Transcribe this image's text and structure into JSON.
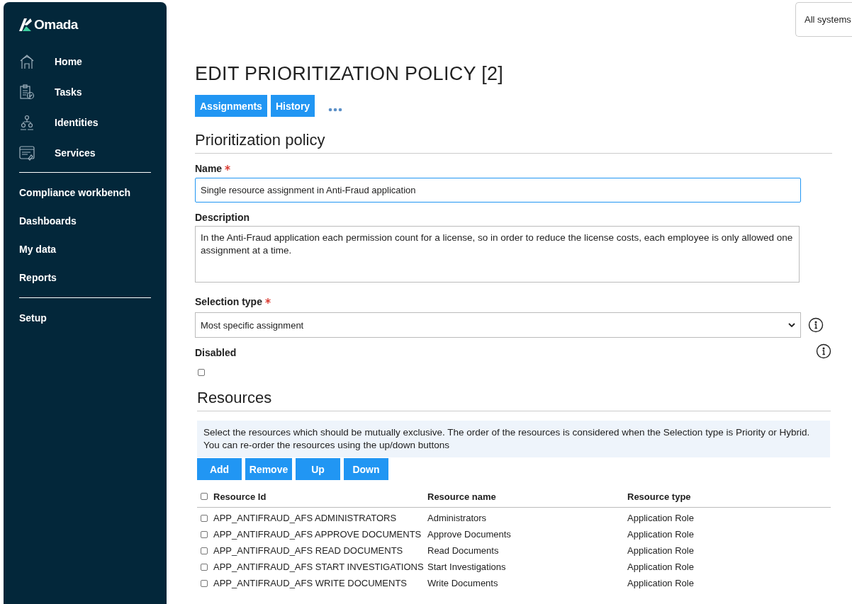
{
  "sidebar": {
    "logo": "Omada",
    "primary_items": [
      {
        "label": "Home"
      },
      {
        "label": "Tasks"
      },
      {
        "label": "Identities"
      },
      {
        "label": "Services"
      }
    ],
    "secondary_items": [
      {
        "label": "Compliance workbench"
      },
      {
        "label": "Dashboards"
      },
      {
        "label": "My data"
      },
      {
        "label": "Reports"
      }
    ],
    "tertiary_items": [
      {
        "label": "Setup"
      }
    ]
  },
  "system_filter": "All systems",
  "page_title": "EDIT PRIORITIZATION POLICY [2]",
  "action_buttons": [
    "Assignments",
    "History"
  ],
  "section_title": "Prioritization policy",
  "name_field": {
    "label": "Name",
    "required": true,
    "value": "Single resource assignment in Anti-Fraud application"
  },
  "description_field": {
    "label": "Description",
    "value": "In the Anti-Fraud application each permission count for a license, so in order to reduce the license costs, each employee is only allowed one assignment at a time."
  },
  "selection_type_field": {
    "label": "Selection type",
    "required": true,
    "value": "Most specific assignment"
  },
  "disabled_field": {
    "label": "Disabled",
    "checked": false
  },
  "resources": {
    "title": "Resources",
    "info": "Select the resources which should be mutually exclusive. The order of the resources is considered when the Selection type is Priority or Hybrid. You can re-order the resources using the up/down buttons",
    "buttons": [
      "Add",
      "Remove",
      "Up",
      "Down"
    ],
    "select_all": false,
    "columns": [
      "Resource Id",
      "Resource name",
      "Resource type"
    ],
    "rows": [
      {
        "checked": false,
        "id": "APP_ANTIFRAUD_AFS ADMINISTRATORS",
        "name": "Administrators",
        "type": "Application Role"
      },
      {
        "checked": false,
        "id": "APP_ANTIFRAUD_AFS APPROVE DOCUMENTS",
        "name": "Approve Documents",
        "type": "Application Role"
      },
      {
        "checked": false,
        "id": "APP_ANTIFRAUD_AFS READ DOCUMENTS",
        "name": "Read Documents",
        "type": "Application Role"
      },
      {
        "checked": false,
        "id": "APP_ANTIFRAUD_AFS START INVESTIGATIONS",
        "name": "Start Investigations",
        "type": "Application Role"
      },
      {
        "checked": false,
        "id": "APP_ANTIFRAUD_AFS WRITE DOCUMENTS",
        "name": "Write Documents",
        "type": "Application Role"
      }
    ]
  }
}
